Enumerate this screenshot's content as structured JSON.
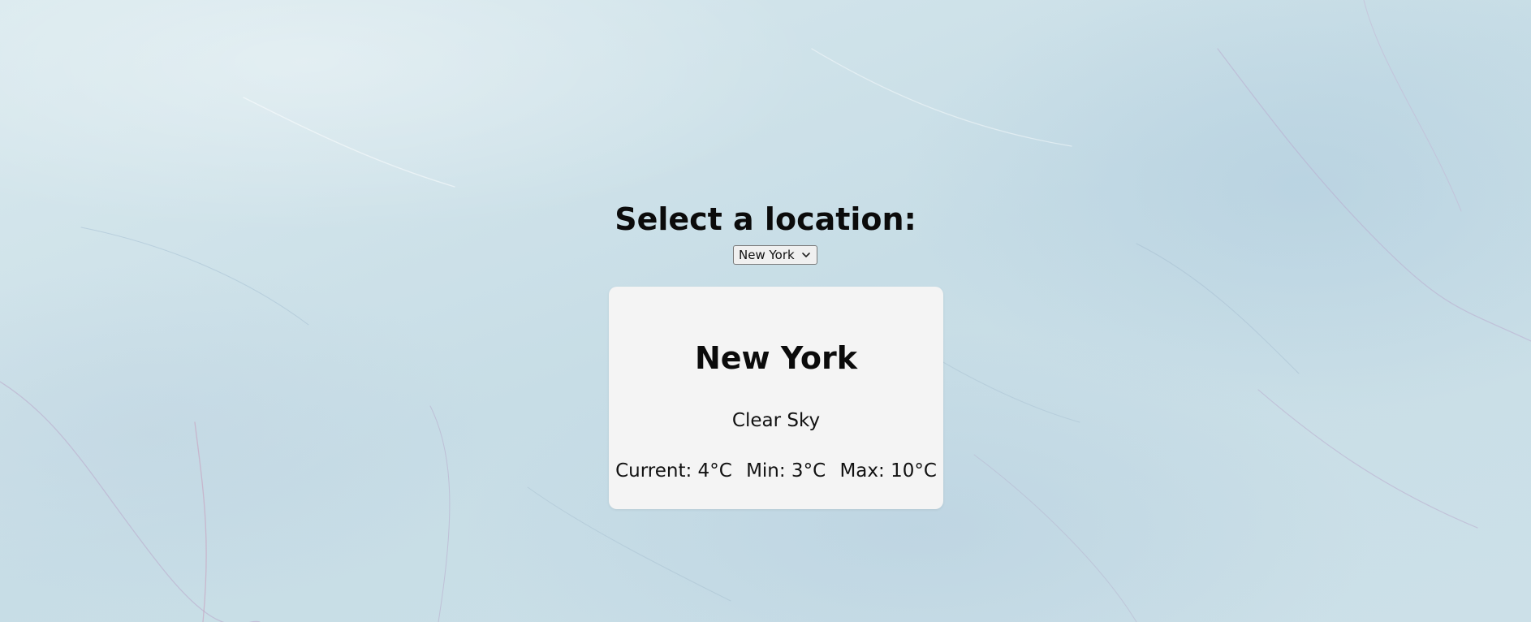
{
  "page": {
    "heading": "Select a location:"
  },
  "location_select": {
    "selected": "New York"
  },
  "weather_card": {
    "city": "New York",
    "condition": "Clear Sky",
    "current": "Current: 4°C",
    "min": "Min: 3°C",
    "max": "Max: 10°C"
  },
  "icons": {
    "dropdown": "chevron-down-icon"
  },
  "colors": {
    "background": "#cfe3ea",
    "card_background": "#f4f4f4",
    "text": "#0b0b0b"
  }
}
